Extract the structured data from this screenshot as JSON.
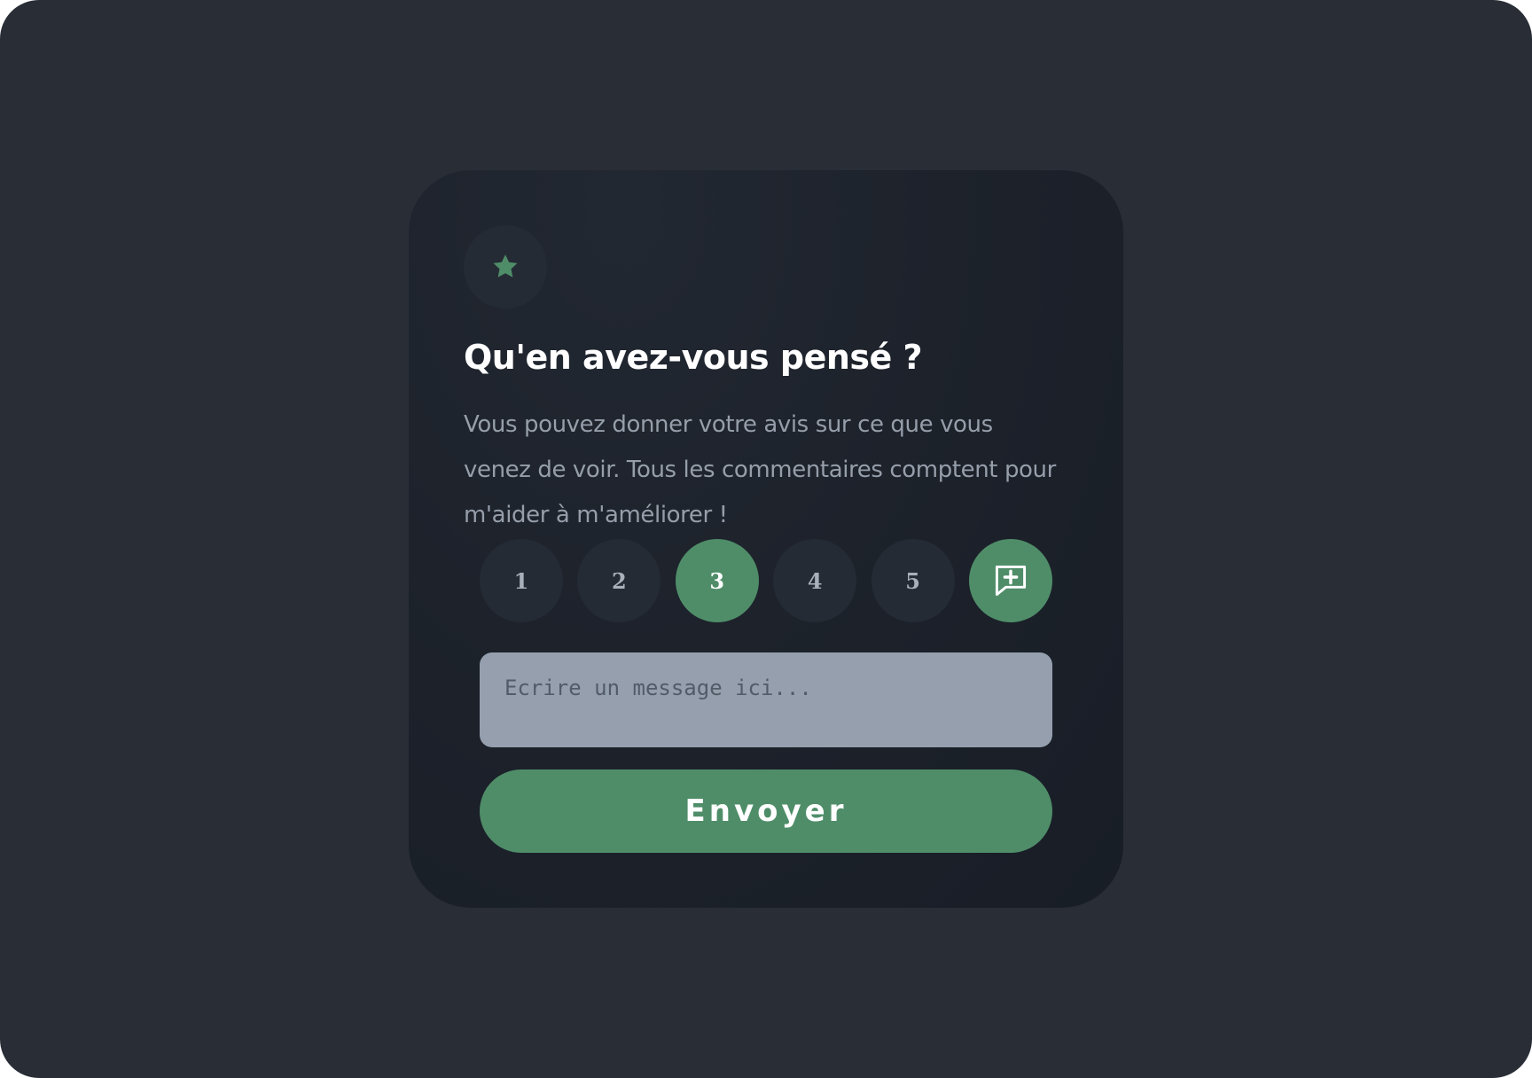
{
  "icons": {
    "badge": "star-icon",
    "comment": "add-comment-icon"
  },
  "colors": {
    "page_background": "#292d36",
    "card_background": "#1d222b",
    "accent": "#4f8d69",
    "muted_circle": "#252b35",
    "input_background": "#959fae"
  },
  "feedback": {
    "title": "Qu'en avez-vous pensé ?",
    "description": "Vous pouvez donner votre avis sur ce que vous venez de voir. Tous les commentaires comptent pour m'aider à m'améliorer !",
    "ratings": [
      "1",
      "2",
      "3",
      "4",
      "5"
    ],
    "selected_rating": "3",
    "message_placeholder": "Ecrire un message ici...",
    "message_value": "",
    "submit_label": "Envoyer"
  }
}
